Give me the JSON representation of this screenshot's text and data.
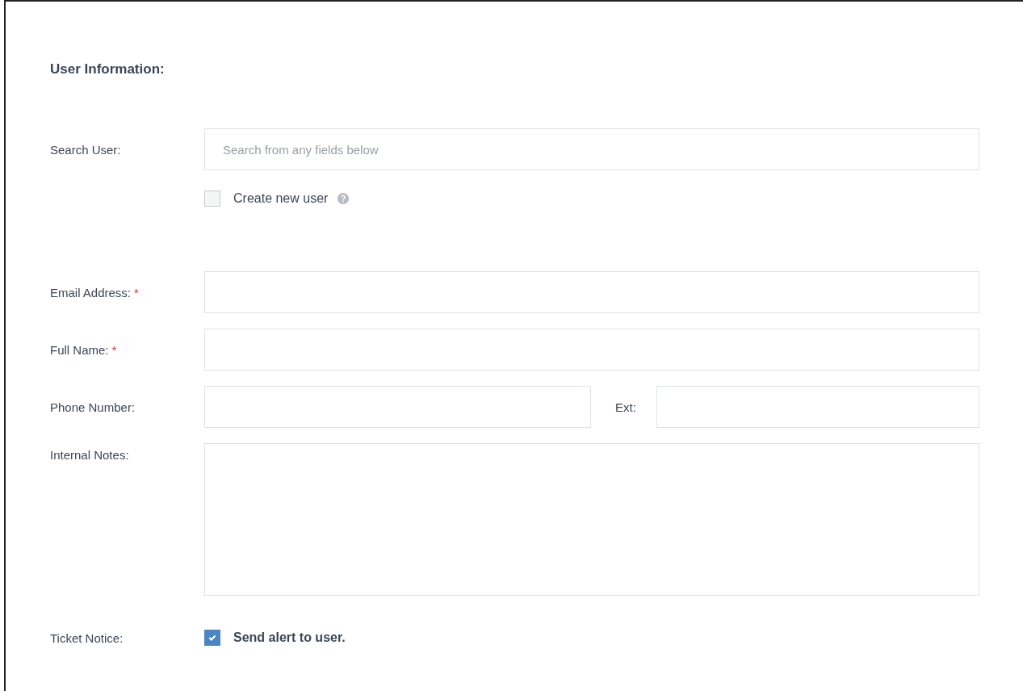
{
  "section_title": "User Information:",
  "search": {
    "label": "Search User:",
    "placeholder": "Search from any fields below"
  },
  "create_new_user": {
    "label": "Create new user",
    "checked": false
  },
  "fields": [
    {
      "kind": "text",
      "label": "Email Address:",
      "required_mark": "*"
    },
    {
      "kind": "text",
      "label": "Full Name:",
      "required_mark": "*"
    },
    {
      "kind": "phone",
      "label": "Phone Number:",
      "ext_label": "Ext:"
    },
    {
      "kind": "textarea",
      "label": "Internal Notes:"
    }
  ],
  "ticket_notice": {
    "label": "Ticket Notice:",
    "option": "Send alert to user.",
    "checked": true
  }
}
